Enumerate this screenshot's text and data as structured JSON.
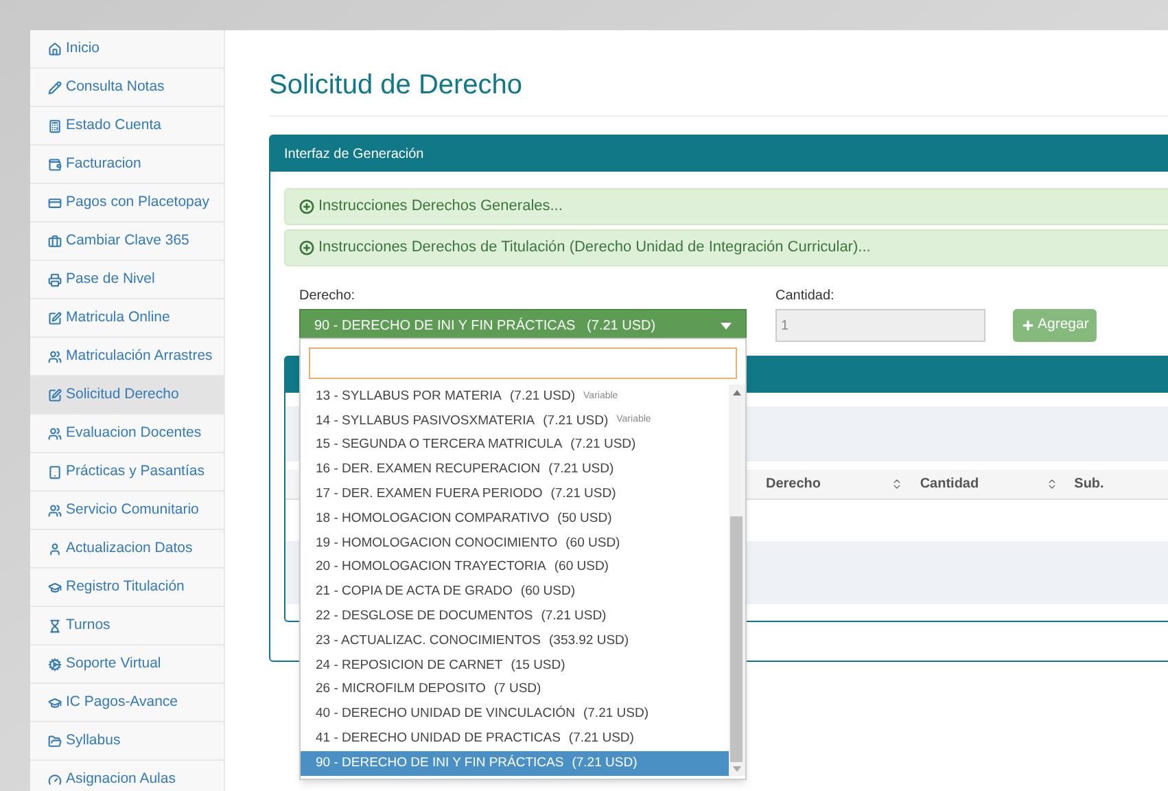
{
  "sidebar": {
    "items": [
      {
        "label": "Inicio",
        "selected": false
      },
      {
        "label": "Consulta Notas",
        "selected": false
      },
      {
        "label": "Estado Cuenta",
        "selected": false
      },
      {
        "label": "Facturacion",
        "selected": false
      },
      {
        "label": "Pagos con Placetopay",
        "selected": false
      },
      {
        "label": "Cambiar Clave 365",
        "selected": false
      },
      {
        "label": "Pase de Nivel",
        "selected": false
      },
      {
        "label": "Matricula Online",
        "selected": false
      },
      {
        "label": "Matriculación Arrastres",
        "selected": false
      },
      {
        "label": "Solicitud Derecho",
        "selected": true
      },
      {
        "label": "Evaluacion Docentes",
        "selected": false
      },
      {
        "label": "Prácticas y Pasantías",
        "selected": false
      },
      {
        "label": "Servicio Comunitario",
        "selected": false
      },
      {
        "label": "Actualizacion Datos",
        "selected": false
      },
      {
        "label": "Registro Titulación",
        "selected": false
      },
      {
        "label": "Turnos",
        "selected": false
      },
      {
        "label": "Soporte Virtual",
        "selected": false
      },
      {
        "label": "IC Pagos-Avance",
        "selected": false
      },
      {
        "label": "Syllabus",
        "selected": false
      },
      {
        "label": "Asignacion Aulas",
        "selected": false
      }
    ]
  },
  "page_title": "Solicitud de Derecho",
  "panel": {
    "title": "Interfaz de Generación",
    "accordions": [
      {
        "label": "Instrucciones Derechos Generales...",
        "expanded": false
      },
      {
        "label": "Instrucciones Derechos de Titulación (Derecho Unidad de Integración Curricular)...",
        "expanded": false
      }
    ],
    "derecho": {
      "label": "Derecho:",
      "value": "90 - DERECHO DE INI Y FIN PRÁCTICAS   (7.21 USD)"
    },
    "cantidad": {
      "label": "Cantidad:",
      "value": "1",
      "disabled": true
    },
    "add_button": "Agregar",
    "table": {
      "columns": [
        "Derecho",
        "Cantidad",
        "Sub."
      ]
    }
  },
  "dropdown": {
    "options": [
      {
        "label": "13 - SYLLABUS POR MATERIA",
        "price": "(7.21 USD)",
        "note": "Variable",
        "selected": false
      },
      {
        "label": "14 - SYLLABUS PASIVOSXMATERIA",
        "price": "(7.21 USD)",
        "note": "Variable",
        "selected": false
      },
      {
        "label": "15 - SEGUNDA O TERCERA MATRICULA",
        "price": "(7.21 USD)",
        "selected": false
      },
      {
        "label": "16 - DER. EXAMEN RECUPERACION",
        "price": "(7.21 USD)",
        "selected": false
      },
      {
        "label": "17 - DER. EXAMEN FUERA PERIODO",
        "price": "(7.21 USD)",
        "selected": false
      },
      {
        "label": "18 - HOMOLOGACION COMPARATIVO",
        "price": "(50 USD)",
        "selected": false
      },
      {
        "label": "19 - HOMOLOGACION CONOCIMIENTO",
        "price": "(60 USD)",
        "selected": false
      },
      {
        "label": "20 - HOMOLOGACION TRAYECTORIA",
        "price": "(60 USD)",
        "selected": false
      },
      {
        "label": "21 - COPIA DE ACTA DE GRADO",
        "price": "(60 USD)",
        "selected": false
      },
      {
        "label": "22 - DESGLOSE DE DOCUMENTOS",
        "price": "(7.21 USD)",
        "selected": false
      },
      {
        "label": "23 - ACTUALIZAC. CONOCIMIENTOS",
        "price": "(353.92 USD)",
        "selected": false
      },
      {
        "label": "24 - REPOSICION DE CARNET",
        "price": "(15 USD)",
        "selected": false
      },
      {
        "label": "26 - MICROFILM DEPOSITO",
        "price": "(7 USD)",
        "selected": false
      },
      {
        "label": "40 - DERECHO UNIDAD DE VINCULACIÓN",
        "price": "(7.21 USD)",
        "selected": false
      },
      {
        "label": "41 - DERECHO UNIDAD DE PRACTICAS",
        "price": "(7.21 USD)",
        "selected": false
      },
      {
        "label": "90 - DERECHO DE INI Y FIN PRÁCTICAS",
        "price": "(7.21 USD)",
        "selected": true
      }
    ]
  }
}
